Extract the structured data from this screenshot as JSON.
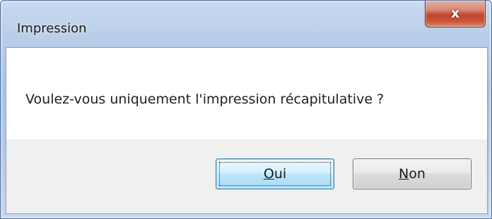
{
  "window": {
    "title": "Impression",
    "close_glyph": "x"
  },
  "message": {
    "text": "Voulez-vous uniquement l'impression récapitulative ?"
  },
  "buttons": {
    "yes": {
      "accel": "O",
      "rest": "ui"
    },
    "no": {
      "accel": "N",
      "rest": "on"
    }
  },
  "colors": {
    "close_button": "#c4442b",
    "default_button_border": "#3c7fb1",
    "client_background": "#f0f0f0",
    "message_background": "#ffffff"
  },
  "icons": {
    "close": "close-icon"
  }
}
